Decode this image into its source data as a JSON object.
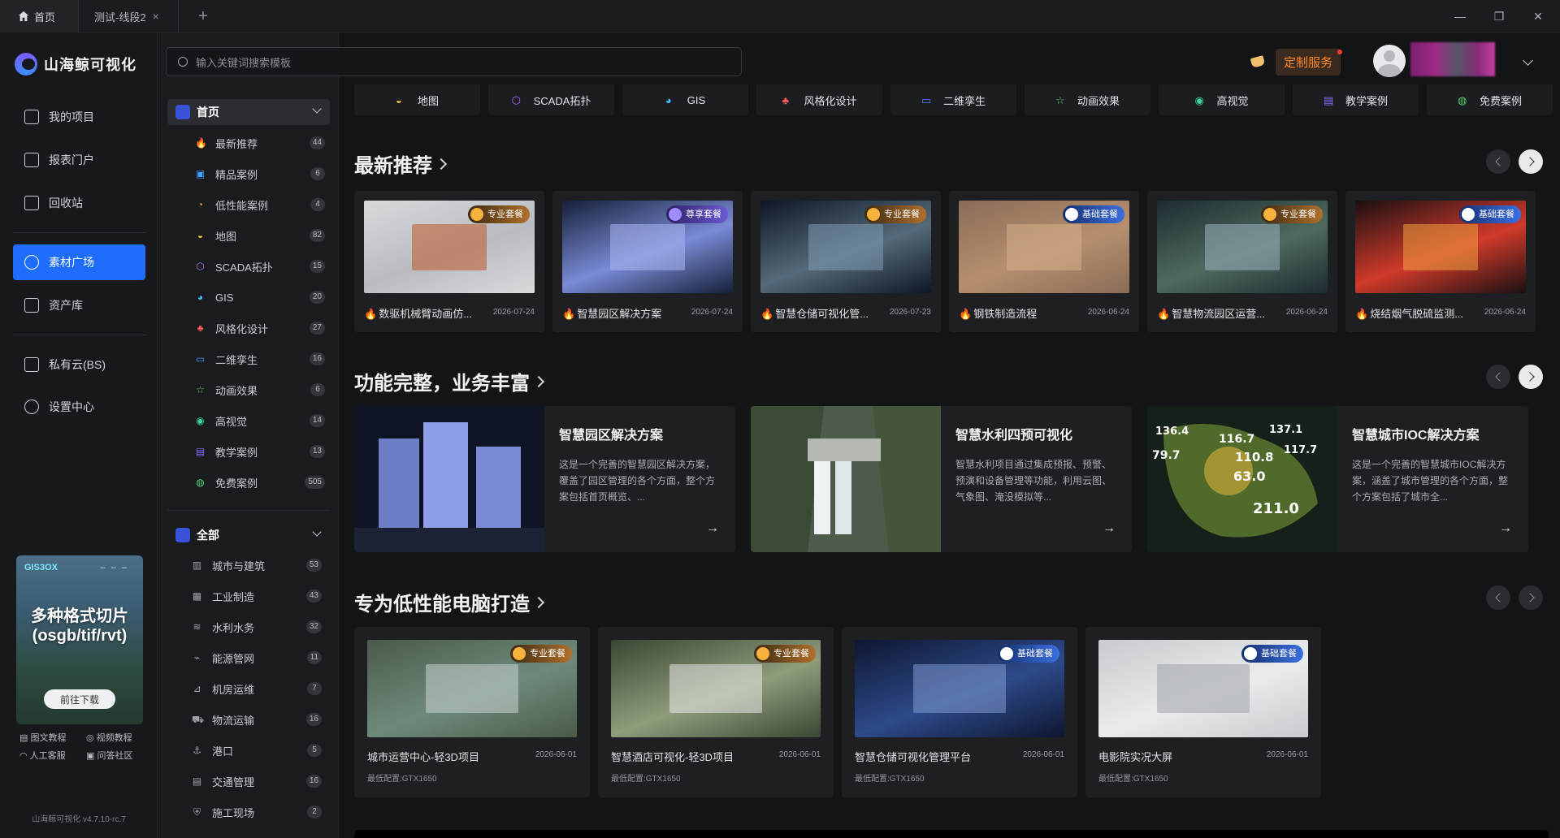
{
  "titlebar": {
    "tabs": [
      {
        "label": "首页"
      },
      {
        "label": "测试-线段2"
      }
    ],
    "add_symbol": "+",
    "window_controls": {
      "minimize": "—",
      "restore": "❐",
      "close": "✕"
    }
  },
  "leftnav": {
    "logo_text": "山海鲸可视化",
    "items": [
      {
        "label": "我的项目",
        "icon": "project-icon"
      },
      {
        "label": "报表门户",
        "icon": "report-icon"
      },
      {
        "label": "回收站",
        "icon": "trash-icon"
      },
      {
        "label": "素材广场",
        "icon": "material-icon",
        "active": true
      },
      {
        "label": "资产库",
        "icon": "asset-icon"
      },
      {
        "label": "私有云(BS)",
        "icon": "cloud-icon"
      },
      {
        "label": "设置中心",
        "icon": "settings-icon"
      }
    ],
    "promo": {
      "brand": "GIS3OX",
      "dashes": "– – –",
      "line1": "多种格式切片",
      "line2": "(osgb/tif/rvt)",
      "button": "前往下载"
    },
    "help": [
      {
        "label": "图文教程",
        "icon": "doc-icon"
      },
      {
        "label": "视频教程",
        "icon": "video-icon"
      },
      {
        "label": "人工客服",
        "icon": "headset-icon"
      },
      {
        "label": "问答社区",
        "icon": "community-icon"
      }
    ],
    "version": "山海鲸可视化 v4.7.10-rc.7"
  },
  "search": {
    "placeholder": "输入关键词搜索模板"
  },
  "header": {
    "custom_service": "定制服务"
  },
  "categories": {
    "home_label": "首页",
    "home_items": [
      {
        "label": "最新推荐",
        "count": "44",
        "icon": "🔥",
        "color": "#ff6a3d"
      },
      {
        "label": "精品案例",
        "count": "6",
        "icon": "▣",
        "color": "#3aa0ff"
      },
      {
        "label": "低性能案例",
        "count": "4",
        "icon": "◔",
        "color": "#e8b23a"
      },
      {
        "label": "地图",
        "count": "82",
        "icon": "◒",
        "color": "#e8c23a"
      },
      {
        "label": "SCADA拓扑",
        "count": "15",
        "icon": "⬡",
        "color": "#b26cff"
      },
      {
        "label": "GIS",
        "count": "20",
        "icon": "◕",
        "color": "#3ac0ff"
      },
      {
        "label": "风格化设计",
        "count": "27",
        "icon": "♣",
        "color": "#ff5a5a"
      },
      {
        "label": "二维孪生",
        "count": "16",
        "icon": "▭",
        "color": "#4a8cff"
      },
      {
        "label": "动画效果",
        "count": "6",
        "icon": "☆",
        "color": "#52d16a"
      },
      {
        "label": "高视觉",
        "count": "14",
        "icon": "◉",
        "color": "#3ad6a0"
      },
      {
        "label": "教学案例",
        "count": "13",
        "icon": "▤",
        "color": "#8b6cff"
      },
      {
        "label": "免费案例",
        "count": "505",
        "icon": "◍",
        "color": "#52d16a"
      }
    ],
    "all_label": "全部",
    "all_items": [
      {
        "label": "城市与建筑",
        "count": "53",
        "icon": "▥"
      },
      {
        "label": "工业制造",
        "count": "43",
        "icon": "▦"
      },
      {
        "label": "水利水务",
        "count": "32",
        "icon": "≋"
      },
      {
        "label": "能源管网",
        "count": "11",
        "icon": "⌁"
      },
      {
        "label": "机房运维",
        "count": "7",
        "icon": "⊿"
      },
      {
        "label": "物流运输",
        "count": "16",
        "icon": "⛟"
      },
      {
        "label": "港口",
        "count": "5",
        "icon": "⚓"
      },
      {
        "label": "交通管理",
        "count": "16",
        "icon": "▤"
      },
      {
        "label": "施工现场",
        "count": "2",
        "icon": "⛨"
      }
    ]
  },
  "catstrip": [
    {
      "label": "地图",
      "icon": "◒",
      "color": "#e8c23a"
    },
    {
      "label": "SCADA拓扑",
      "icon": "⬡",
      "color": "#b26cff"
    },
    {
      "label": "GIS",
      "icon": "◕",
      "color": "#3ac0ff"
    },
    {
      "label": "风格化设计",
      "icon": "♣",
      "color": "#ff5a5a"
    },
    {
      "label": "二维孪生",
      "icon": "▭",
      "color": "#4a8cff"
    },
    {
      "label": "动画效果",
      "icon": "☆",
      "color": "#52d16a"
    },
    {
      "label": "高视觉",
      "icon": "◉",
      "color": "#3ad6a0"
    },
    {
      "label": "教学案例",
      "icon": "▤",
      "color": "#8b6cff"
    },
    {
      "label": "免费案例",
      "icon": "◍",
      "color": "#52d16a"
    }
  ],
  "sections": {
    "latest": {
      "title": "最新推荐",
      "cards": [
        {
          "title": "数驱机械臂动画仿...",
          "date": "2026-07-24",
          "badge": "专业套餐",
          "tier": "pro"
        },
        {
          "title": "智慧园区解决方案",
          "date": "2026-07-24",
          "badge": "尊享套餐",
          "tier": "vip"
        },
        {
          "title": "智慧仓储可视化管...",
          "date": "2026-07-23",
          "badge": "专业套餐",
          "tier": "pro"
        },
        {
          "title": "钢铁制造流程",
          "date": "2026-06-24",
          "badge": "基础套餐",
          "tier": "basic"
        },
        {
          "title": "智慧物流园区运营...",
          "date": "2026-06-24",
          "badge": "专业套餐",
          "tier": "pro"
        },
        {
          "title": "烧结烟气脱硫监测...",
          "date": "2026-06-24",
          "badge": "基础套餐",
          "tier": "basic"
        }
      ]
    },
    "full": {
      "title": "功能完整，业务丰富",
      "cards": [
        {
          "title": "智慧园区解决方案",
          "desc": "这是一个完善的智慧园区解决方案，覆盖了园区管理的各个方面，整个方案包括首页概览、..."
        },
        {
          "title": "智慧水利四预可视化",
          "desc": "智慧水利项目通过集成预报、预警、预演和设备管理等功能，利用云图、气象图、淹没模拟等..."
        },
        {
          "title": "智慧城市IOC解决方案",
          "desc": "这是一个完善的智慧城市IOC解决方案，涵盖了城市管理的各个方面，整个方案包括了城市全..."
        }
      ],
      "map_labels": [
        "136.4",
        "116.7",
        "137.1",
        "79.7",
        "110.8",
        "117.7",
        "63.0",
        "211.0"
      ]
    },
    "lowperf": {
      "title": "专为低性能电脑打造",
      "cards": [
        {
          "title": "城市运营中心-轻3D项目",
          "date": "2026-06-01",
          "spec": "最低配置:GTX1650",
          "badge": "专业套餐",
          "tier": "pro"
        },
        {
          "title": "智慧酒店可视化-轻3D项目",
          "date": "2026-06-01",
          "spec": "最低配置:GTX1650",
          "badge": "专业套餐",
          "tier": "pro"
        },
        {
          "title": "智慧仓储可视化管理平台",
          "date": "2026-06-01",
          "spec": "最低配置:GTX1650",
          "badge": "基础套餐",
          "tier": "basic"
        },
        {
          "title": "电影院实况大屏",
          "date": "2026-06-01",
          "spec": "最低配置:GTX1650",
          "badge": "基础套餐",
          "tier": "basic"
        }
      ]
    }
  },
  "symbols": {
    "fire": "🔥",
    "arrow": "→"
  }
}
